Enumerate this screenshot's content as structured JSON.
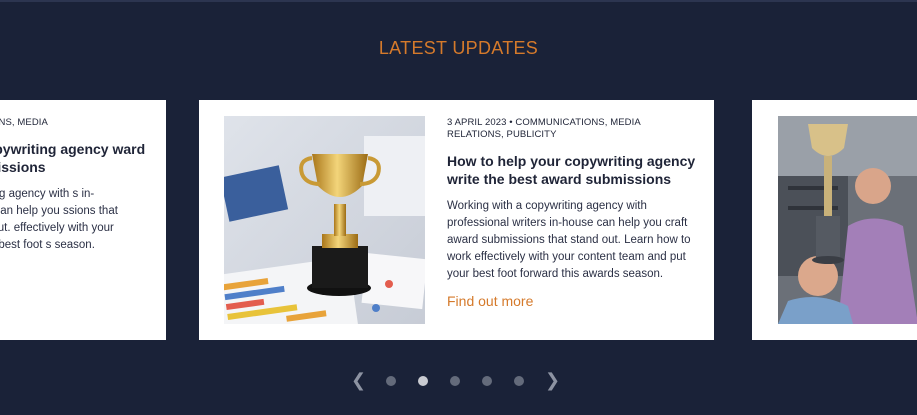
{
  "section": {
    "title": "LATEST UPDATES"
  },
  "colors": {
    "background": "#1a2238",
    "accent": "#d57a2b",
    "card": "#ffffff"
  },
  "cards": [
    {
      "meta": "NICATIONS, MEDIA",
      "headline": "ur copywriting agency ward submissions",
      "excerpt": "pywriting agency with s in-house can help you ssions that stand out. effectively with your ut your best foot s season."
    },
    {
      "meta": "3 APRIL 2023 • COMMUNICATIONS, MEDIA RELATIONS, PUBLICITY",
      "headline": "How to help your copywriting agency write the best award submissions",
      "excerpt": "Working with a copywriting agency with professional writers in-house can help you craft award submissions that stand out. Learn how to work effectively with your content team and put your best foot forward this awards season.",
      "link": "Find out more",
      "image": "trophy-on-desk"
    },
    {
      "image": "team-celebrating-with-trophy"
    }
  ],
  "pager": {
    "prev_icon": "chevron-left-icon",
    "next_icon": "chevron-right-icon",
    "prev_glyph": "❮",
    "next_glyph": "❯",
    "dot_count": 5,
    "active_index": 1
  }
}
